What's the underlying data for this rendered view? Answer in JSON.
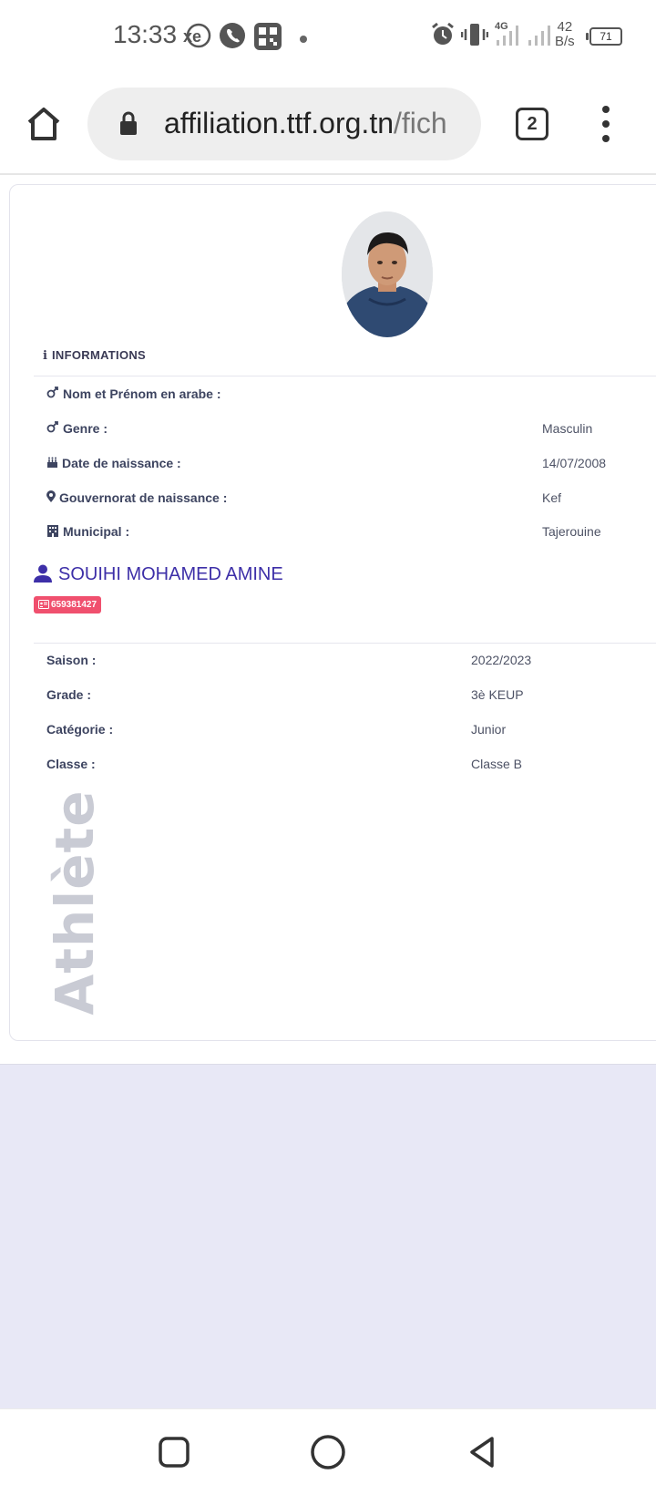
{
  "status_bar": {
    "time": "13:33",
    "xe_label": "xe",
    "net_speed_value": "42",
    "net_speed_unit": "B/s",
    "network_type": "4G",
    "battery": "71",
    "icons": [
      "xe-icon",
      "phone-icon",
      "qr-app-icon",
      "dot-icon",
      "alarm-icon",
      "vibrate-icon",
      "signal-icon",
      "signal-icon-2"
    ]
  },
  "browser": {
    "url_host": "affiliation.ttf.org.tn",
    "url_path": "/fich",
    "tab_count": "2",
    "icons": [
      "home-icon",
      "lock-icon",
      "tabs-icon",
      "more-vert-icon"
    ]
  },
  "profile": {
    "section_title": "INFORMATIONS",
    "info_rows": [
      {
        "icon": "gender-icon",
        "label": "Nom et Prénom en arabe :",
        "value": ""
      },
      {
        "icon": "gender-icon",
        "label": "Genre :",
        "value": "Masculin"
      },
      {
        "icon": "birthday-cake-icon",
        "label": "Date de naissance :",
        "value": "14/07/2008"
      },
      {
        "icon": "map-marker-icon",
        "label": "Gouvernorat de naissance :",
        "value": "Kef"
      },
      {
        "icon": "building-icon",
        "label": "Municipal :",
        "value": "Tajerouine"
      }
    ],
    "athlete_name": "SOUIHI MOHAMED AMINE",
    "athlete_id": "659381427",
    "season_rows": [
      {
        "label": "Saison :",
        "value": "2022/2023"
      },
      {
        "label": "Grade :",
        "value": "3è KEUP"
      },
      {
        "label": "Catégorie :",
        "value": "Junior"
      },
      {
        "label": "Classe :",
        "value": "Classe B"
      }
    ],
    "watermark": "Athlète"
  },
  "colors": {
    "accent": "#3d2fa8",
    "badge": "#f0506e",
    "label": "#3d4460",
    "background_lower": "#e8e8f6"
  },
  "navbar": {
    "icons": [
      "recent-apps-icon",
      "home-circle-icon",
      "back-icon"
    ]
  }
}
